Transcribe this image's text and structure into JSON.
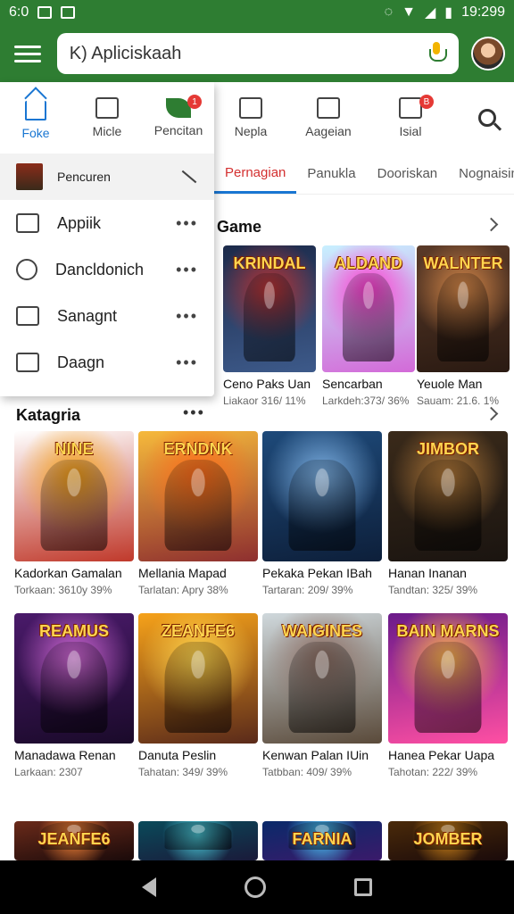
{
  "status_bar": {
    "time_left": "6:0",
    "time_right": "19:299"
  },
  "search": {
    "query": "K) Apliciskaah"
  },
  "top_tabs": [
    {
      "label": "Micle",
      "icon": "list-icon"
    },
    {
      "label": "Pencitan",
      "icon": "leaf-icon",
      "badge": "1"
    },
    {
      "label": "Nepla",
      "icon": "mail-icon"
    },
    {
      "label": "Aageian",
      "icon": "grid-icon"
    },
    {
      "label": "Isial",
      "icon": "account-icon",
      "badge": "B"
    }
  ],
  "drawer": {
    "tabs": [
      {
        "label": "Foke",
        "icon": "home-icon",
        "active": true
      },
      {
        "label": "Micle",
        "icon": "list-icon"
      },
      {
        "label": "Pencitan",
        "icon": "leaf-icon",
        "badge": "1"
      }
    ],
    "user": {
      "name": "Pencuren"
    },
    "items": [
      {
        "label": "Appiik",
        "icon": "app-icon"
      },
      {
        "label": "Dancldonich",
        "icon": "clock-icon"
      },
      {
        "label": "Sanagnt",
        "icon": "library-icon"
      },
      {
        "label": "Daagn",
        "icon": "boat-icon"
      }
    ]
  },
  "text_tabs": [
    {
      "label": "Pernagian",
      "active": true
    },
    {
      "label": "Panukla"
    },
    {
      "label": "Dooriskan"
    },
    {
      "label": "Nognaisin"
    }
  ],
  "game_section": {
    "title": "Game",
    "cards": [
      {
        "art": "KRINDAL",
        "name": "Ceno Paks Uan",
        "meta": "Liakaor 316/ 11%",
        "colors": [
          "#1c2a4a",
          "#3d5a8a",
          "#b33"
        ]
      },
      {
        "art": "ALDAND",
        "name": "Sencarban",
        "meta": "Larkdeh:373/ 36%",
        "colors": [
          "#c8f0ff",
          "#d36ad8",
          "#ff3bd0"
        ]
      },
      {
        "art": "WALNTER",
        "name": "Yeuole Man",
        "meta": "Sauam: 21.6. 1%",
        "colors": [
          "#5a3a28",
          "#2a1a12",
          "#d98a4a"
        ]
      }
    ]
  },
  "category_section": {
    "title": "Katagria",
    "cards": [
      {
        "art": "NINE",
        "name": "Kadorkan Gamalan",
        "meta": "Torkaan: 3610y  39%",
        "colors": [
          "#ffffff",
          "#c0392b",
          "#f39c12"
        ]
      },
      {
        "art": "ERNDNK",
        "name": "Mellania Mapad",
        "meta": "Tarlatan: Apry  38%",
        "colors": [
          "#f6b93b",
          "#8e2f2f",
          "#ff6b1a"
        ]
      },
      {
        "art": "",
        "name": "Pekaka Pekan IBah",
        "meta": "Tartaran: 209/  39%",
        "colors": [
          "#1e4a7a",
          "#0d1f3a",
          "#7fb3e6"
        ]
      },
      {
        "art": "JIMBOR",
        "name": "Hanan Inanan",
        "meta": "Tandtan: 325/  39%",
        "colors": [
          "#3a2a1a",
          "#1a1410",
          "#b37a3a"
        ]
      },
      {
        "art": "REAMUS",
        "name": "Manadawa Renan",
        "meta": "Larkaan: 2307",
        "colors": [
          "#4a1a6a",
          "#1a0a2a",
          "#d36ad8"
        ]
      },
      {
        "art": "ZEANFE6",
        "name": "Danuta Peslin",
        "meta": "Tahatan: 349/  39%",
        "colors": [
          "#f6a21a",
          "#5a2a1a",
          "#ffd54f"
        ]
      },
      {
        "art": "WAIGINES",
        "name": "Kenwan Palan IUin",
        "meta": "Tatbban: 409/  39%",
        "colors": [
          "#cfd8dc",
          "#5a4a3a",
          "#8d6e63"
        ]
      },
      {
        "art": "BAIN MARNS",
        "name": "Hanea Pekar Uapa",
        "meta": "Tahotan: 222/  39%",
        "colors": [
          "#6a1a8a",
          "#ff4fa3",
          "#ffb74d"
        ]
      }
    ]
  },
  "bottom_row": [
    {
      "art": "JEANFE6",
      "colors": [
        "#6a2a1a",
        "#1a0a0a",
        "#ff8a3a"
      ]
    },
    {
      "art": "",
      "colors": [
        "#0a4a5a",
        "#1a1a3a",
        "#4fd0e0"
      ]
    },
    {
      "art": "FARNIA",
      "colors": [
        "#0a2a6a",
        "#3a1a6a",
        "#4fd0ff"
      ]
    },
    {
      "art": "JOMBER",
      "colors": [
        "#4a2a0a",
        "#1a0a0a",
        "#d98a1a"
      ]
    }
  ]
}
